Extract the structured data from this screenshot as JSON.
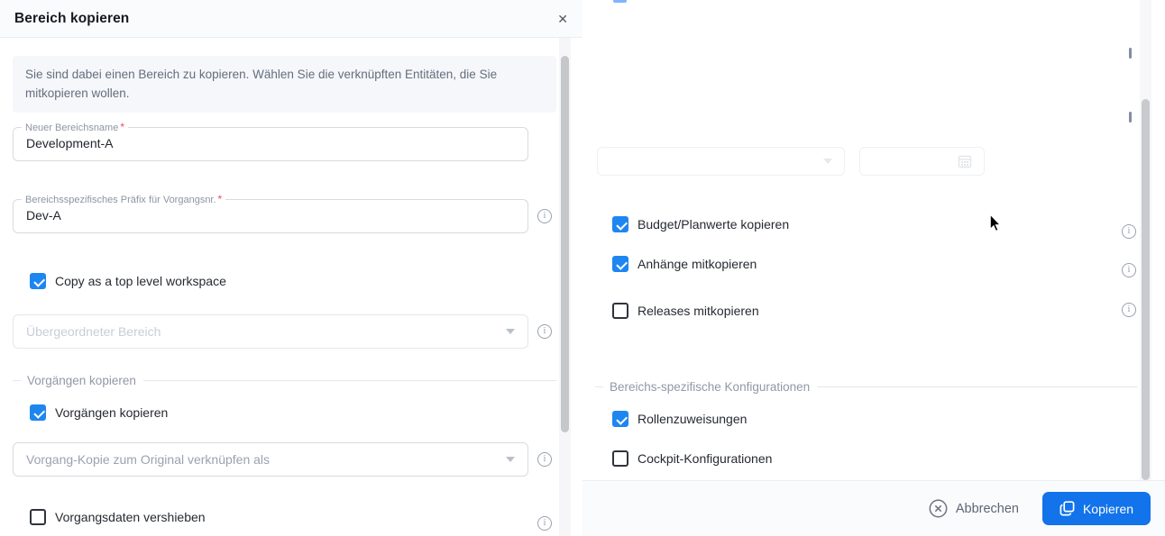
{
  "dialog": {
    "title": "Bereich kopieren"
  },
  "icons": {
    "close_glyph": "✕",
    "info_glyph": "i",
    "chevron_down": "css-triangle",
    "calendar": "svg-grid",
    "cancel_circle_x": "svg",
    "copy_squares": "svg",
    "mouse_cursor": "arrow-pointer"
  },
  "misc": {
    "required_marker": "*"
  },
  "left": {
    "info_banner": "Sie sind dabei einen Bereich zu kopieren. Wählen Sie die verknüpften Entitäten, die Sie mitkopieren wollen.",
    "name_field": {
      "label": "Neuer Bereichsname",
      "value": "Development-A",
      "required": true
    },
    "prefix_field": {
      "label": "Bereichsspezifisches Präfix für Vorgangsnr.",
      "value": "Dev-A",
      "required": true
    },
    "top_level_checkbox": {
      "label": "Copy as a top level workspace",
      "checked": true
    },
    "parent_select": {
      "placeholder": "Übergeordneter Bereich",
      "disabled": true
    },
    "section_label": "Vorgängen kopieren",
    "copy_items_checkbox": {
      "label": "Vorgängen kopieren",
      "checked": true
    },
    "link_select": {
      "placeholder": "Vorgang-Kopie zum Original verknüpfen als"
    },
    "move_data_checkbox": {
      "label": "Vorgangsdaten vershieben",
      "checked": false
    }
  },
  "right": {
    "options": [
      {
        "label": "Budget/Planwerte kopieren",
        "checked": true
      },
      {
        "label": "Anhänge mitkopieren",
        "checked": true
      },
      {
        "label": "Releases mitkopieren",
        "checked": false
      }
    ],
    "section_label": "Bereichs-spezifische Konfigurationen",
    "configs": [
      {
        "label": "Rollenzuweisungen",
        "checked": true
      },
      {
        "label": "Cockpit-Konfigurationen",
        "checked": false
      }
    ]
  },
  "footer": {
    "cancel_label": "Abbrechen",
    "submit_label": "Kopieren"
  },
  "colors": {
    "accent_blue": "#1273eb",
    "checkbox_blue": "#1e86f0",
    "banner_bg": "#f6f7fa",
    "required_red": "#f0485c"
  }
}
